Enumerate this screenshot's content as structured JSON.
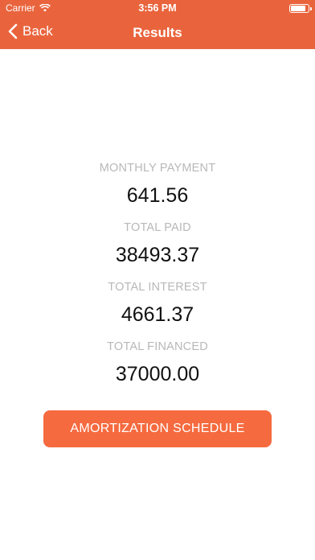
{
  "status_bar": {
    "carrier": "Carrier",
    "time": "3:56 PM",
    "battery_level": 0.85
  },
  "nav": {
    "back_label": "Back",
    "title": "Results"
  },
  "results": [
    {
      "label": "MONTHLY PAYMENT",
      "value": "641.56"
    },
    {
      "label": "TOTAL PAID",
      "value": "38493.37"
    },
    {
      "label": "TOTAL INTEREST",
      "value": "4661.37"
    },
    {
      "label": "TOTAL FINANCED",
      "value": "37000.00"
    }
  ],
  "button": {
    "label": "AMORTIZATION SCHEDULE"
  },
  "colors": {
    "header": "#E9643D",
    "button": "#F56A3F",
    "label": "#B8B8B8",
    "value": "#111111"
  }
}
